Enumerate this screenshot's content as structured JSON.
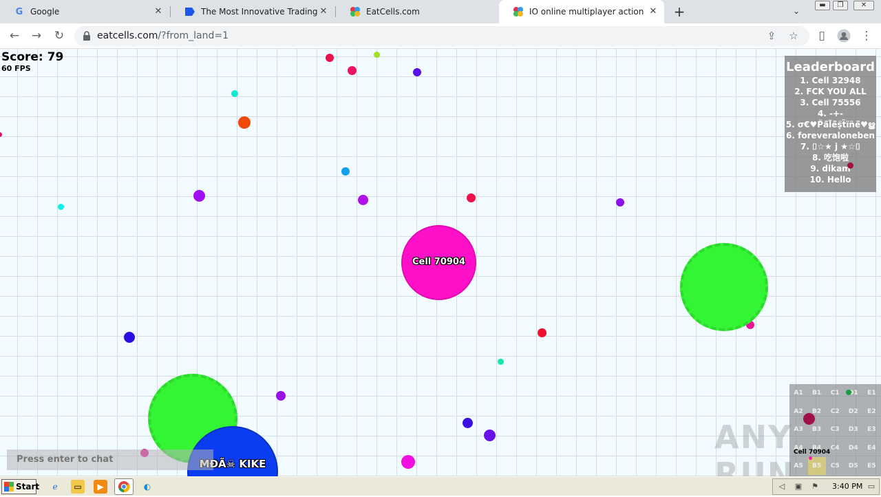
{
  "browser": {
    "tabs": [
      {
        "title": "Google",
        "favicon": "google-g-icon",
        "active": false
      },
      {
        "title": "The Most Innovative Trading Platform",
        "favicon": "trading-platform-icon",
        "active": false
      },
      {
        "title": "EatCells.com",
        "favicon": "eatcells-icon",
        "active": false
      },
      {
        "title": "IO online multiplayer action game. Su",
        "favicon": "eatcells-icon",
        "active": true
      }
    ],
    "new_tab_label": "+",
    "tab_search_label": "⌄",
    "url_domain": "eatcells.com",
    "url_path": "/?from_land=1"
  },
  "game": {
    "score_text": "Score: 79",
    "fps_text": "60 FPS",
    "leaderboard": {
      "title": "Leaderboard",
      "entries": [
        "1. Cell 32948",
        "2. FCK YOU ALL",
        "3. Cell 75556",
        "4. -+-",
        "5. σ€♥P̈ä̈l̈ë̈ṣ̈ẗïn̈ë̈♥ൠ",
        "6. foreveraloneben",
        "7. ⌷☆★ j ★☆⌷",
        "8. 吃饱啦",
        "9. dikam",
        "10. Hello"
      ]
    },
    "player_cells": [
      {
        "name": "Cell 70904",
        "color": "#ff10c8"
      },
      {
        "name": "MĐÃ☠ KIKE",
        "color": "#0a3cf0"
      }
    ],
    "other_cell_color": "#33f533",
    "chat_hint": "Press enter to chat",
    "minimap": {
      "labels": [
        "A1",
        "B1",
        "C1",
        "D1",
        "E1",
        "A2",
        "B2",
        "C2",
        "D2",
        "E2",
        "A3",
        "B3",
        "C3",
        "D3",
        "E3",
        "A4",
        "B4",
        "C4",
        "D4",
        "E4",
        "A5",
        "B5",
        "C5",
        "D5",
        "E5"
      ],
      "current_sector": "B5",
      "player_label": "Cell 70904"
    },
    "watermark": "ANY RUN"
  },
  "taskbar": {
    "start_label": "Start",
    "clock": "3:40 PM"
  }
}
